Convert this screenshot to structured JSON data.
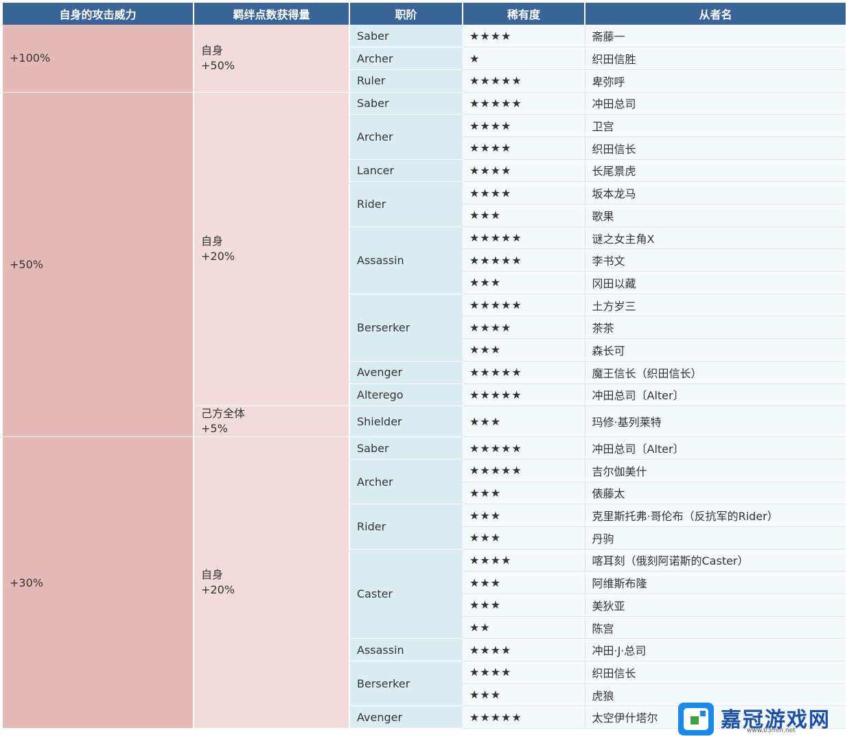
{
  "headers": {
    "atk": "自身的攻击威力",
    "bond": "羁绊点数获得量",
    "cls": "职阶",
    "rarity": "稀有度",
    "name": "从者名"
  },
  "groups": [
    {
      "atk": "+100%",
      "bonds": [
        {
          "target": "自身",
          "amount": "+50%",
          "classes": [
            {
              "name": "Saber",
              "servants": [
                {
                  "rarity": "★★★★",
                  "name": "斋藤一"
                }
              ]
            },
            {
              "name": "Archer",
              "servants": [
                {
                  "rarity": "★",
                  "name": "织田信胜"
                }
              ]
            },
            {
              "name": "Ruler",
              "servants": [
                {
                  "rarity": "★★★★★",
                  "name": "卑弥呼"
                }
              ]
            }
          ]
        }
      ]
    },
    {
      "atk": "+50%",
      "bonds": [
        {
          "target": "自身",
          "amount": "+20%",
          "classes": [
            {
              "name": "Saber",
              "servants": [
                {
                  "rarity": "★★★★★",
                  "name": "冲田总司"
                }
              ]
            },
            {
              "name": "Archer",
              "servants": [
                {
                  "rarity": "★★★★",
                  "name": "卫宫"
                },
                {
                  "rarity": "★★★★",
                  "name": "织田信长"
                }
              ]
            },
            {
              "name": "Lancer",
              "servants": [
                {
                  "rarity": "★★★★",
                  "name": "长尾景虎"
                }
              ]
            },
            {
              "name": "Rider",
              "servants": [
                {
                  "rarity": "★★★★",
                  "name": "坂本龙马"
                },
                {
                  "rarity": "★★★",
                  "name": "歌果"
                }
              ]
            },
            {
              "name": "Assassin",
              "servants": [
                {
                  "rarity": "★★★★★",
                  "name": "谜之女主角X"
                },
                {
                  "rarity": "★★★★★",
                  "name": "李书文"
                },
                {
                  "rarity": "★★★",
                  "name": "冈田以藏"
                }
              ]
            },
            {
              "name": "Berserker",
              "servants": [
                {
                  "rarity": "★★★★★",
                  "name": "土方岁三"
                },
                {
                  "rarity": "★★★★",
                  "name": "茶茶"
                },
                {
                  "rarity": "★★★",
                  "name": "森长可"
                }
              ]
            },
            {
              "name": "Avenger",
              "servants": [
                {
                  "rarity": "★★★★★",
                  "name": "魔王信长（织田信长）"
                }
              ]
            },
            {
              "name": "Alterego",
              "servants": [
                {
                  "rarity": "★★★★★",
                  "name": "冲田总司〔Alter〕"
                }
              ]
            }
          ]
        },
        {
          "target": "己方全体",
          "amount": "+5%",
          "classes": [
            {
              "name": "Shielder",
              "servants": [
                {
                  "rarity": "★★★",
                  "name": "玛修·基列莱特"
                }
              ]
            }
          ]
        }
      ]
    },
    {
      "atk": "+30%",
      "bonds": [
        {
          "target": "自身",
          "amount": "+20%",
          "classes": [
            {
              "name": "Saber",
              "servants": [
                {
                  "rarity": "★★★★★",
                  "name": "冲田总司〔Alter〕"
                }
              ]
            },
            {
              "name": "Archer",
              "servants": [
                {
                  "rarity": "★★★★★",
                  "name": "吉尔伽美什"
                },
                {
                  "rarity": "★★★",
                  "name": "俵藤太"
                }
              ]
            },
            {
              "name": "Rider",
              "servants": [
                {
                  "rarity": "★★★",
                  "name": "克里斯托弗·哥伦布（反抗军的Rider）"
                },
                {
                  "rarity": "★★★",
                  "name": "丹驹"
                }
              ]
            },
            {
              "name": "Caster",
              "servants": [
                {
                  "rarity": "★★★★",
                  "name": "喀耳刻（俄刻阿诺斯的Caster）"
                },
                {
                  "rarity": "★★★",
                  "name": "阿维斯布隆"
                },
                {
                  "rarity": "★★★",
                  "name": "美狄亚"
                },
                {
                  "rarity": "★★",
                  "name": "陈宫"
                }
              ]
            },
            {
              "name": "Assassin",
              "servants": [
                {
                  "rarity": "★★★★",
                  "name": "冲田·J·总司"
                }
              ]
            },
            {
              "name": "Berserker",
              "servants": [
                {
                  "rarity": "★★★★",
                  "name": "织田信长"
                },
                {
                  "rarity": "★★★",
                  "name": "虎狼"
                }
              ]
            },
            {
              "name": "Avenger",
              "servants": [
                {
                  "rarity": "★★★★★",
                  "name": "太空伊什塔尔"
                }
              ]
            }
          ]
        }
      ]
    }
  ],
  "watermark": {
    "text": "嘉冠游戏网",
    "url": "www.03mm.net"
  }
}
